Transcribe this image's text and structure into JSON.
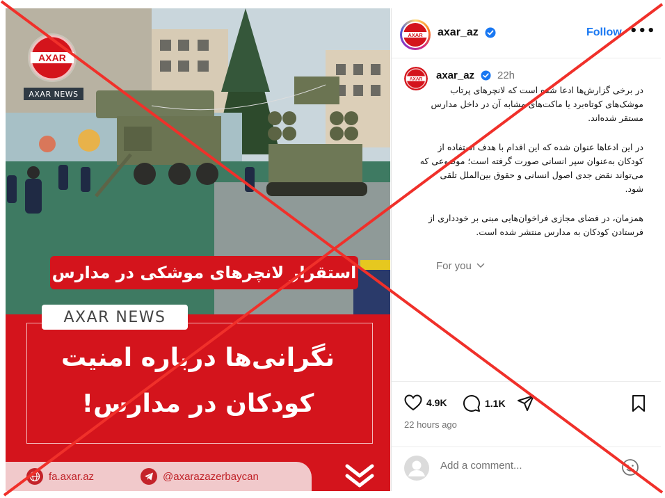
{
  "post_image": {
    "title_banner": "استقرار لانچرهای موشکی در مدارس",
    "logo_text": "AXAR",
    "news_tag": "AXAR NEWS",
    "brand_pill": "AXAR NEWS",
    "headline_line1": "نگرانی‌ها درباره امنیت",
    "headline_line2": "کودکان در مدارس!",
    "footer_website": "fa.axar.az",
    "footer_telegram": "@axarazazerbaycan"
  },
  "header": {
    "avatar_text": "AXAR",
    "username": "axar_az",
    "follow_label": "Follow",
    "more_label": "•••"
  },
  "caption": {
    "username": "axar_az",
    "time": "22h",
    "para1": "در برخی گزارش‌ها ادعا شده است که لانچرهای پرتاب موشک‌های کوتاه‌برد یا ماکت‌های مشابه آن در داخل مدارس مستقر شده‌اند.",
    "para2": "در این ادعاها عنوان شده که این اقدام با هدف استفاده از کودکان به‌عنوان سپر انسانی صورت گرفته است؛ موضوعی که می‌تواند نقض جدی اصول انسانی و حقوق بین‌الملل تلقی شود.",
    "para3": "همزمان، در فضای مجازی فراخوان‌هایی مبنی بر خودداری از فرستادن کودکان به مدارس منتشر شده است.",
    "for_you": "For you"
  },
  "actions": {
    "likes": "4.9K",
    "comments": "1.1K",
    "time_ago": "22 hours ago"
  },
  "comment": {
    "placeholder": "Add a comment..."
  },
  "colors": {
    "axar_red": "#d4141c",
    "instagram_blue": "#1877f2",
    "cross_red": "#f0302a"
  },
  "icons": [
    "heart-icon",
    "comment-icon",
    "share-icon",
    "bookmark-icon",
    "emoji-icon",
    "verified-icon",
    "globe-icon",
    "telegram-icon",
    "chevron-down-icon"
  ]
}
